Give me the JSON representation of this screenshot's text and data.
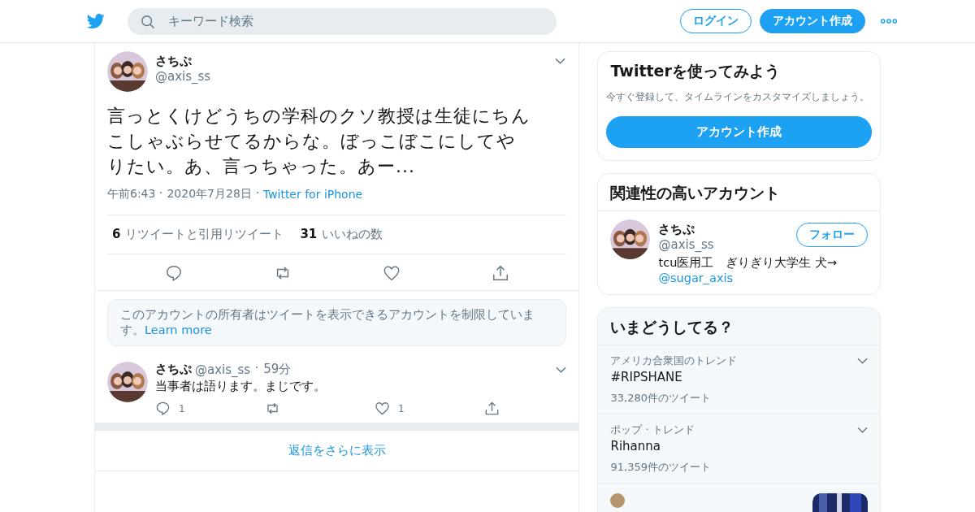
{
  "header": {
    "search": {
      "placeholder": "キーワード検索"
    },
    "buttons": [
      {
        "label": "ログイン",
        "kind": "outline"
      },
      {
        "label": "アカウント作成",
        "kind": "filled"
      }
    ]
  },
  "tweet": {
    "name": "さちぷ",
    "handle": "@axis_ss",
    "text": "言っとくけどうちの学科のクソ教授は生徒にちんこしゃぶらせてるからな。ぼっこぼこにしてやりたい。あ、言っちゃった。あー...",
    "time": "午前6:43",
    "date": "2020年7月28日",
    "source": "Twitter for iPhone",
    "stats": [
      {
        "count": "6",
        "label": "リツイートと引用リツイート"
      },
      {
        "count": "31",
        "label": "いいねの数"
      }
    ]
  },
  "notice": {
    "text": "このアカウントの所有者はツイートを表示できるアカウントを制限しています。",
    "link": "Learn more"
  },
  "reply": {
    "name": "さちぷ",
    "handle": "@axis_ss",
    "time": "59分",
    "text": "当事者は語ります。まじです。",
    "counts": [
      {
        "kind": "reply",
        "count": "1"
      },
      {
        "kind": "retweet"
      },
      {
        "kind": "like",
        "count": "1"
      },
      {
        "kind": "share"
      }
    ]
  },
  "more_replies": "返信をさらに表示",
  "signup": {
    "title": "Twitterを使ってみよう",
    "text": "今すぐ登録して、タイムラインをカスタマイズしましょう。",
    "button": "アカウント作成"
  },
  "related": {
    "title": "関連性の高いアカウント",
    "account": {
      "name": "さちぷ",
      "handle": "@axis_ss",
      "button": "フォロー",
      "bio": "tcu医用工　ぎりぎり大学生 犬→",
      "bio_link": "@sugar_axis"
    }
  },
  "trends": {
    "title": "いまどうしてる？",
    "items": [
      {
        "context": "アメリカ合衆国のトレンド",
        "name": "#RIPSHANE",
        "count": "33,280件のツイート"
      },
      {
        "context": "ポップ · トレンド",
        "name": "Rihanna",
        "count": "91,359件のツイート"
      },
      {
        "kind": "picture"
      }
    ]
  }
}
